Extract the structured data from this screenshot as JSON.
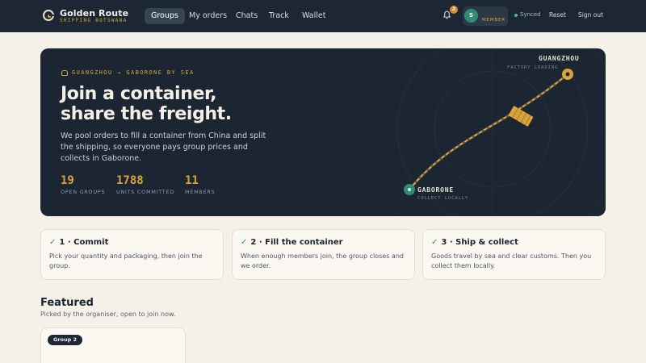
{
  "nav": {
    "brand": "Golden Route",
    "brand_sub": "SHIPPING BOTSWANA",
    "tabs": [
      {
        "label": "Groups",
        "active": true
      },
      {
        "label": "My orders",
        "active": false
      },
      {
        "label": "Chats",
        "active": false
      },
      {
        "label": "Track",
        "active": false
      },
      {
        "label": "Wallet",
        "active": false
      }
    ],
    "notification_count": "2",
    "avatar_initial": "S",
    "member_label": "MEMBER",
    "sync_status": "Synced",
    "reset_label": "Reset",
    "signout_label": "Sign out"
  },
  "hero": {
    "route_tag": "GUANGZHOU → GABORONE BY SEA",
    "title_line1": "Join a container,",
    "title_line2": "share the freight.",
    "description": "We pool orders to fill a container from China and split the shipping, so everyone pays group prices and collects in Gaborone.",
    "stats": [
      {
        "value": "19",
        "label": "OPEN GROUPS"
      },
      {
        "value": "1788",
        "label": "UNITS COMMITTED"
      },
      {
        "value": "11",
        "label": "MEMBERS"
      }
    ],
    "map": {
      "origin_name": "GUANGZHOU",
      "origin_note": "FACTORY LOADING",
      "dest_name": "GABORONE",
      "dest_note": "COLLECT LOCALLY"
    }
  },
  "steps": [
    {
      "check": "✓",
      "title": "1 · Commit",
      "body": "Pick your quantity and packaging, then join the group."
    },
    {
      "check": "✓",
      "title": "2 · Fill the container",
      "body": "When enough members join, the group closes and we order."
    },
    {
      "check": "✓",
      "title": "3 · Ship & collect",
      "body": "Goods travel by sea and clear customs. Then you collect them locally."
    }
  ],
  "featured": {
    "title": "Featured",
    "subtitle": "Picked by the organiser, open to join now.",
    "cards": [
      {
        "badge": "Group 2"
      }
    ]
  },
  "colors": {
    "nav_bg": "#1d2733",
    "accent_gold": "#d9a43a",
    "accent_green": "#2f8d74",
    "page_bg": "#f6f1e8"
  }
}
